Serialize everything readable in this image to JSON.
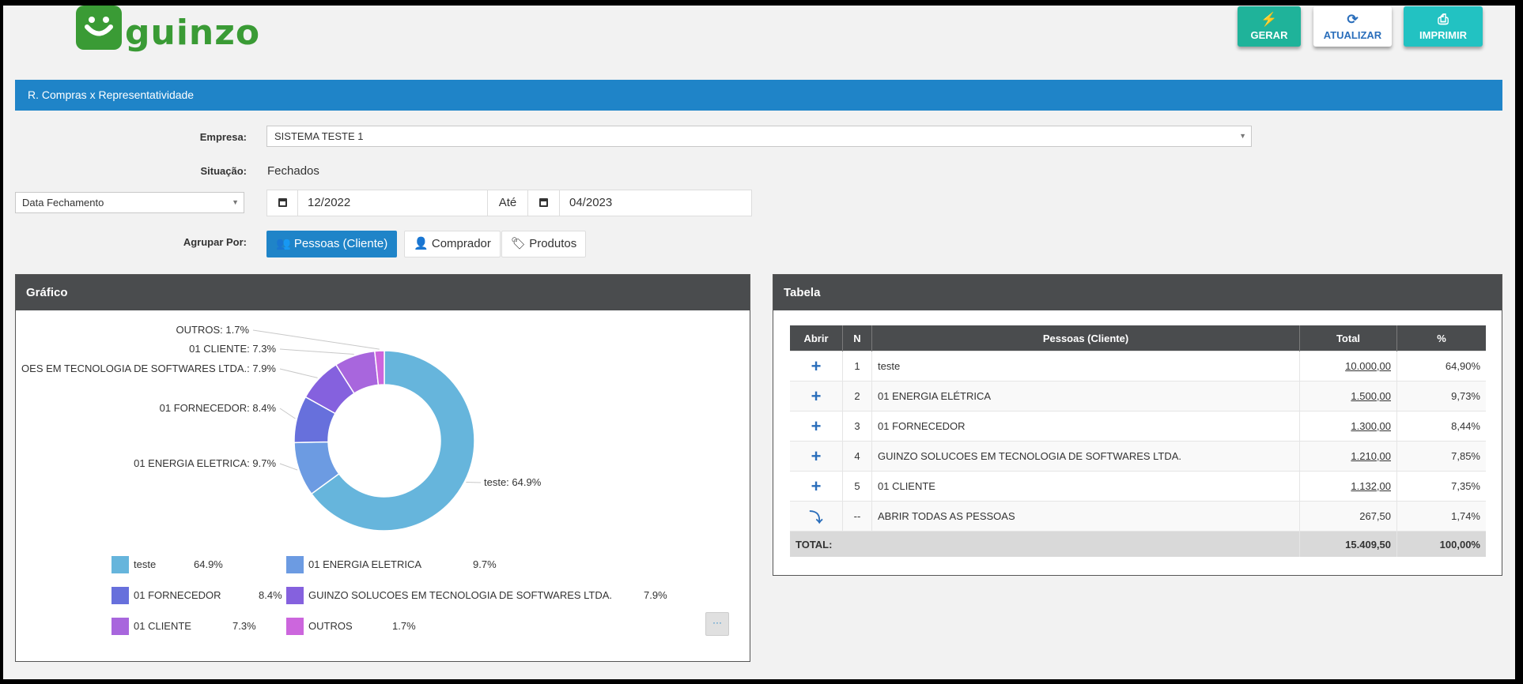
{
  "brand": {
    "name": "guinzo",
    "color": "#3a9b35"
  },
  "toolbar": {
    "gerar_label": "GERAR",
    "atualizar_label": "ATUALIZAR",
    "imprimir_label": "IMPRIMIR"
  },
  "report_title": "R. Compras x Representatividade",
  "form": {
    "empresa_label": "Empresa:",
    "empresa_value": "SISTEMA TESTE 1",
    "situacao_label": "Situação:",
    "situacao_value": "Fechados",
    "date_field_value": "Data Fechamento",
    "date_from": "12/2022",
    "ate_label": "Até",
    "date_to": "04/2023",
    "agrupar_label": "Agrupar Por:",
    "group_options": [
      "Pessoas (Cliente)",
      "Comprador",
      "Produtos"
    ]
  },
  "chart_panel": {
    "title": "Gráfico",
    "more_label": "···"
  },
  "chart_data": {
    "type": "pie",
    "donut": true,
    "slices": [
      {
        "label": "teste",
        "value": 64.9,
        "color": "#66b5dc",
        "chart_label": "teste: 64.9%",
        "pct_text": "64.9%"
      },
      {
        "label": "01 ENERGIA ELETRICA",
        "value": 9.7,
        "color": "#6c9be2",
        "chart_label": "01 ENERGIA ELETRICA: 9.7%",
        "pct_text": "9.7%"
      },
      {
        "label": "01 FORNECEDOR",
        "value": 8.4,
        "color": "#6770dc",
        "chart_label": "01 FORNECEDOR: 8.4%",
        "pct_text": "8.4%"
      },
      {
        "label": "GUINZO SOLUCOES EM TECNOLOGIA DE SOFTWARES LTDA.",
        "value": 7.9,
        "color": "#8561de",
        "chart_label": "OES EM TECNOLOGIA DE SOFTWARES LTDA.: 7.9%",
        "pct_text": "7.9%"
      },
      {
        "label": "01 CLIENTE",
        "value": 7.3,
        "color": "#a866dd",
        "chart_label": "01 CLIENTE: 7.3%",
        "pct_text": "7.3%"
      },
      {
        "label": "OUTROS",
        "value": 1.7,
        "color": "#cc66dd",
        "chart_label": "OUTROS: 1.7%",
        "pct_text": "1.7%"
      }
    ],
    "legend_placement": "bottom"
  },
  "table_panel": {
    "title": "Tabela",
    "headers": [
      "Abrir",
      "N",
      "Pessoas (Cliente)",
      "Total",
      "%"
    ],
    "rows": [
      {
        "n": "1",
        "name": "teste",
        "total": "10.000,00",
        "pct": "64,90%"
      },
      {
        "n": "2",
        "name": "01 ENERGIA ELÉTRICA",
        "total": "1.500,00",
        "pct": "9,73%"
      },
      {
        "n": "3",
        "name": "01 FORNECEDOR",
        "total": "1.300,00",
        "pct": "8,44%"
      },
      {
        "n": "4",
        "name": "GUINZO SOLUCOES EM TECNOLOGIA DE SOFTWARES LTDA.",
        "total": "1.210,00",
        "pct": "7,85%"
      },
      {
        "n": "5",
        "name": "01 CLIENTE",
        "total": "1.132,00",
        "pct": "7,35%"
      }
    ],
    "open_all": {
      "n": "--",
      "name": "ABRIR TODAS AS PESSOAS",
      "total": "267,50",
      "pct": "1,74%"
    },
    "total_row": {
      "label": "TOTAL:",
      "total": "15.409,50",
      "pct": "100,00%"
    }
  }
}
